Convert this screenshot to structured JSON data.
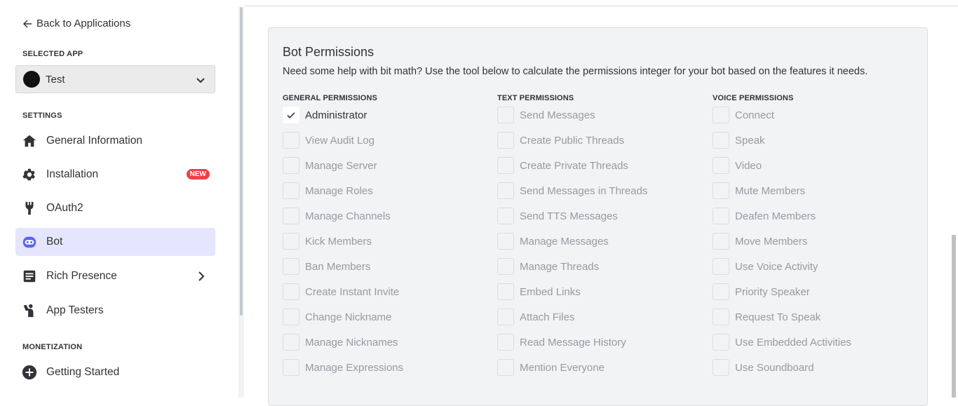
{
  "sidebar": {
    "back_label": "Back to Applications",
    "selected_app_heading": "SELECTED APP",
    "selected_app_name": "Test",
    "settings_heading": "SETTINGS",
    "items": [
      {
        "label": "General Information",
        "icon": "home-icon"
      },
      {
        "label": "Installation",
        "icon": "gear-icon",
        "badge": "NEW"
      },
      {
        "label": "OAuth2",
        "icon": "wrench-icon"
      },
      {
        "label": "Bot",
        "icon": "bot-icon",
        "active": true
      },
      {
        "label": "Rich Presence",
        "icon": "document-icon"
      },
      {
        "label": "App Testers",
        "icon": "person-wave-icon"
      }
    ],
    "monetization_heading": "MONETIZATION",
    "monetization_items": [
      {
        "label": "Getting Started",
        "icon": "plus-circle-icon"
      }
    ]
  },
  "card": {
    "title": "Bot Permissions",
    "description": "Need some help with bit math? Use the tool below to calculate the permissions integer for your bot based on the features it needs."
  },
  "columns": [
    {
      "heading": "GENERAL PERMISSIONS",
      "items": [
        {
          "label": "Administrator",
          "checked": true
        },
        {
          "label": "View Audit Log",
          "checked": false
        },
        {
          "label": "Manage Server",
          "checked": false
        },
        {
          "label": "Manage Roles",
          "checked": false
        },
        {
          "label": "Manage Channels",
          "checked": false
        },
        {
          "label": "Kick Members",
          "checked": false
        },
        {
          "label": "Ban Members",
          "checked": false
        },
        {
          "label": "Create Instant Invite",
          "checked": false
        },
        {
          "label": "Change Nickname",
          "checked": false
        },
        {
          "label": "Manage Nicknames",
          "checked": false
        },
        {
          "label": "Manage Expressions",
          "checked": false
        }
      ]
    },
    {
      "heading": "TEXT PERMISSIONS",
      "items": [
        {
          "label": "Send Messages",
          "checked": false
        },
        {
          "label": "Create Public Threads",
          "checked": false
        },
        {
          "label": "Create Private Threads",
          "checked": false
        },
        {
          "label": "Send Messages in Threads",
          "checked": false
        },
        {
          "label": "Send TTS Messages",
          "checked": false
        },
        {
          "label": "Manage Messages",
          "checked": false
        },
        {
          "label": "Manage Threads",
          "checked": false
        },
        {
          "label": "Embed Links",
          "checked": false
        },
        {
          "label": "Attach Files",
          "checked": false
        },
        {
          "label": "Read Message History",
          "checked": false
        },
        {
          "label": "Mention Everyone",
          "checked": false
        }
      ]
    },
    {
      "heading": "VOICE PERMISSIONS",
      "items": [
        {
          "label": "Connect",
          "checked": false
        },
        {
          "label": "Speak",
          "checked": false
        },
        {
          "label": "Video",
          "checked": false
        },
        {
          "label": "Mute Members",
          "checked": false
        },
        {
          "label": "Deafen Members",
          "checked": false
        },
        {
          "label": "Move Members",
          "checked": false
        },
        {
          "label": "Use Voice Activity",
          "checked": false
        },
        {
          "label": "Priority Speaker",
          "checked": false
        },
        {
          "label": "Request To Speak",
          "checked": false
        },
        {
          "label": "Use Embedded Activities",
          "checked": false
        },
        {
          "label": "Use Soundboard",
          "checked": false
        }
      ]
    }
  ],
  "colors": {
    "active_nav": "#e5e6fd",
    "badge": "#f23f42",
    "disabled_text": "#979aa0",
    "card_bg": "#f2f3f5"
  }
}
